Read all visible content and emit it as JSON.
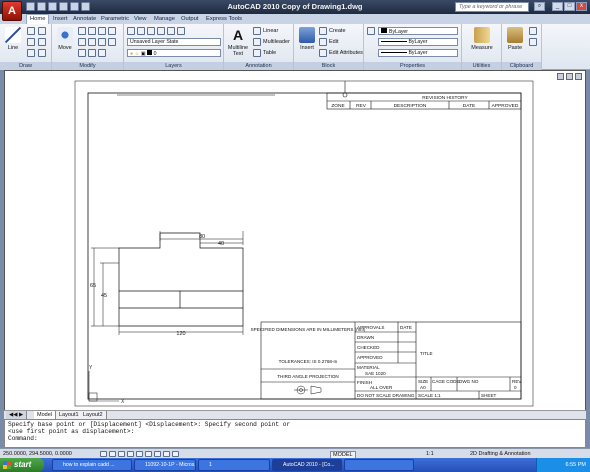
{
  "window": {
    "title": "AutoCAD 2010     Copy of Drawing1.dwg",
    "search_placeholder": "Type a keyword or phrase",
    "min": "_",
    "max": "□",
    "close": "x"
  },
  "tabs": [
    "Home",
    "Insert",
    "Annotate",
    "Parametric",
    "View",
    "Manage",
    "Output",
    "Express Tools"
  ],
  "ribbon": {
    "draw": {
      "line": "Line",
      "label": "Draw"
    },
    "modify": {
      "move": "Move",
      "label": "Modify"
    },
    "layers": {
      "state": "Unsaved Layer State",
      "layer": "0",
      "label": "Layers"
    },
    "annotation": {
      "mtext": "Multiline Text",
      "linear": "Linear",
      "multileader": "Multileader",
      "table": "Table",
      "label": "Annotation"
    },
    "block": {
      "insert": "Insert",
      "create": "Create",
      "edit": "Edit",
      "edit_attr": "Edit Attributes",
      "label": "Block"
    },
    "properties": {
      "color": "ByLayer",
      "linetype": "ByLayer",
      "lineweight": "ByLayer",
      "label": "Properties"
    },
    "utilities": {
      "measure": "Measure",
      "label": "Utilities"
    },
    "clipboard": {
      "paste": "Paste",
      "label": "Clipboard"
    }
  },
  "drawing": {
    "revision": {
      "title": "REVISION HISTORY",
      "zone": "ZONE",
      "rev": "REV",
      "description": "DESCRIPTION",
      "date": "DATE",
      "approved": "APPROVED"
    },
    "dims": {
      "d80": "80",
      "d40": "40",
      "d65": "65",
      "d45": "45",
      "d120": "120"
    },
    "title_block": {
      "spec": "SPECIFIED DIMENSIONS ARE IN MILLIMETERS (mm)",
      "tol": "TOLERANCES: IS 0.2768-m",
      "projection": "THIRD ANGLE PROJECTION",
      "approvals": "APPROVALS",
      "date": "DATE",
      "drawn": "DRAWN",
      "checked": "CHECKED",
      "approved": "APPROVED",
      "material": "MATERIAL",
      "material_val": "SAE 1020",
      "finish": "FINISH",
      "finish_val": "ALL OVER",
      "no_scale": "DO NOT SCALE DRAWING",
      "title": "TITLE",
      "size": "SIZE",
      "size_val": "A0",
      "cage": "CAGE CODE",
      "dwg": "DWG NO",
      "rev": "REV",
      "rev_val": "0",
      "scale": "SCALE 1:1",
      "sheet": "SHEET"
    }
  },
  "layout_tabs": [
    "Model",
    "Layout1",
    "Layout2"
  ],
  "command": {
    "line1": "Specify base point or [Displacement] <Displacement>: Specify second point or",
    "line2": "<use first point as displacement>:",
    "line3": "Command:"
  },
  "status": {
    "coords": "250.0000, 294.5000, 0.0000",
    "model": "MODEL",
    "scale": "1:1",
    "workspace": "2D Drafting & Annotation"
  },
  "taskbar": {
    "start": "start",
    "items": [
      "how to explain cadd ...",
      "11092-10-1P - Micros...",
      "1",
      "AutoCAD 2010 - [Co...",
      ""
    ],
    "time": "6:55 PM"
  }
}
